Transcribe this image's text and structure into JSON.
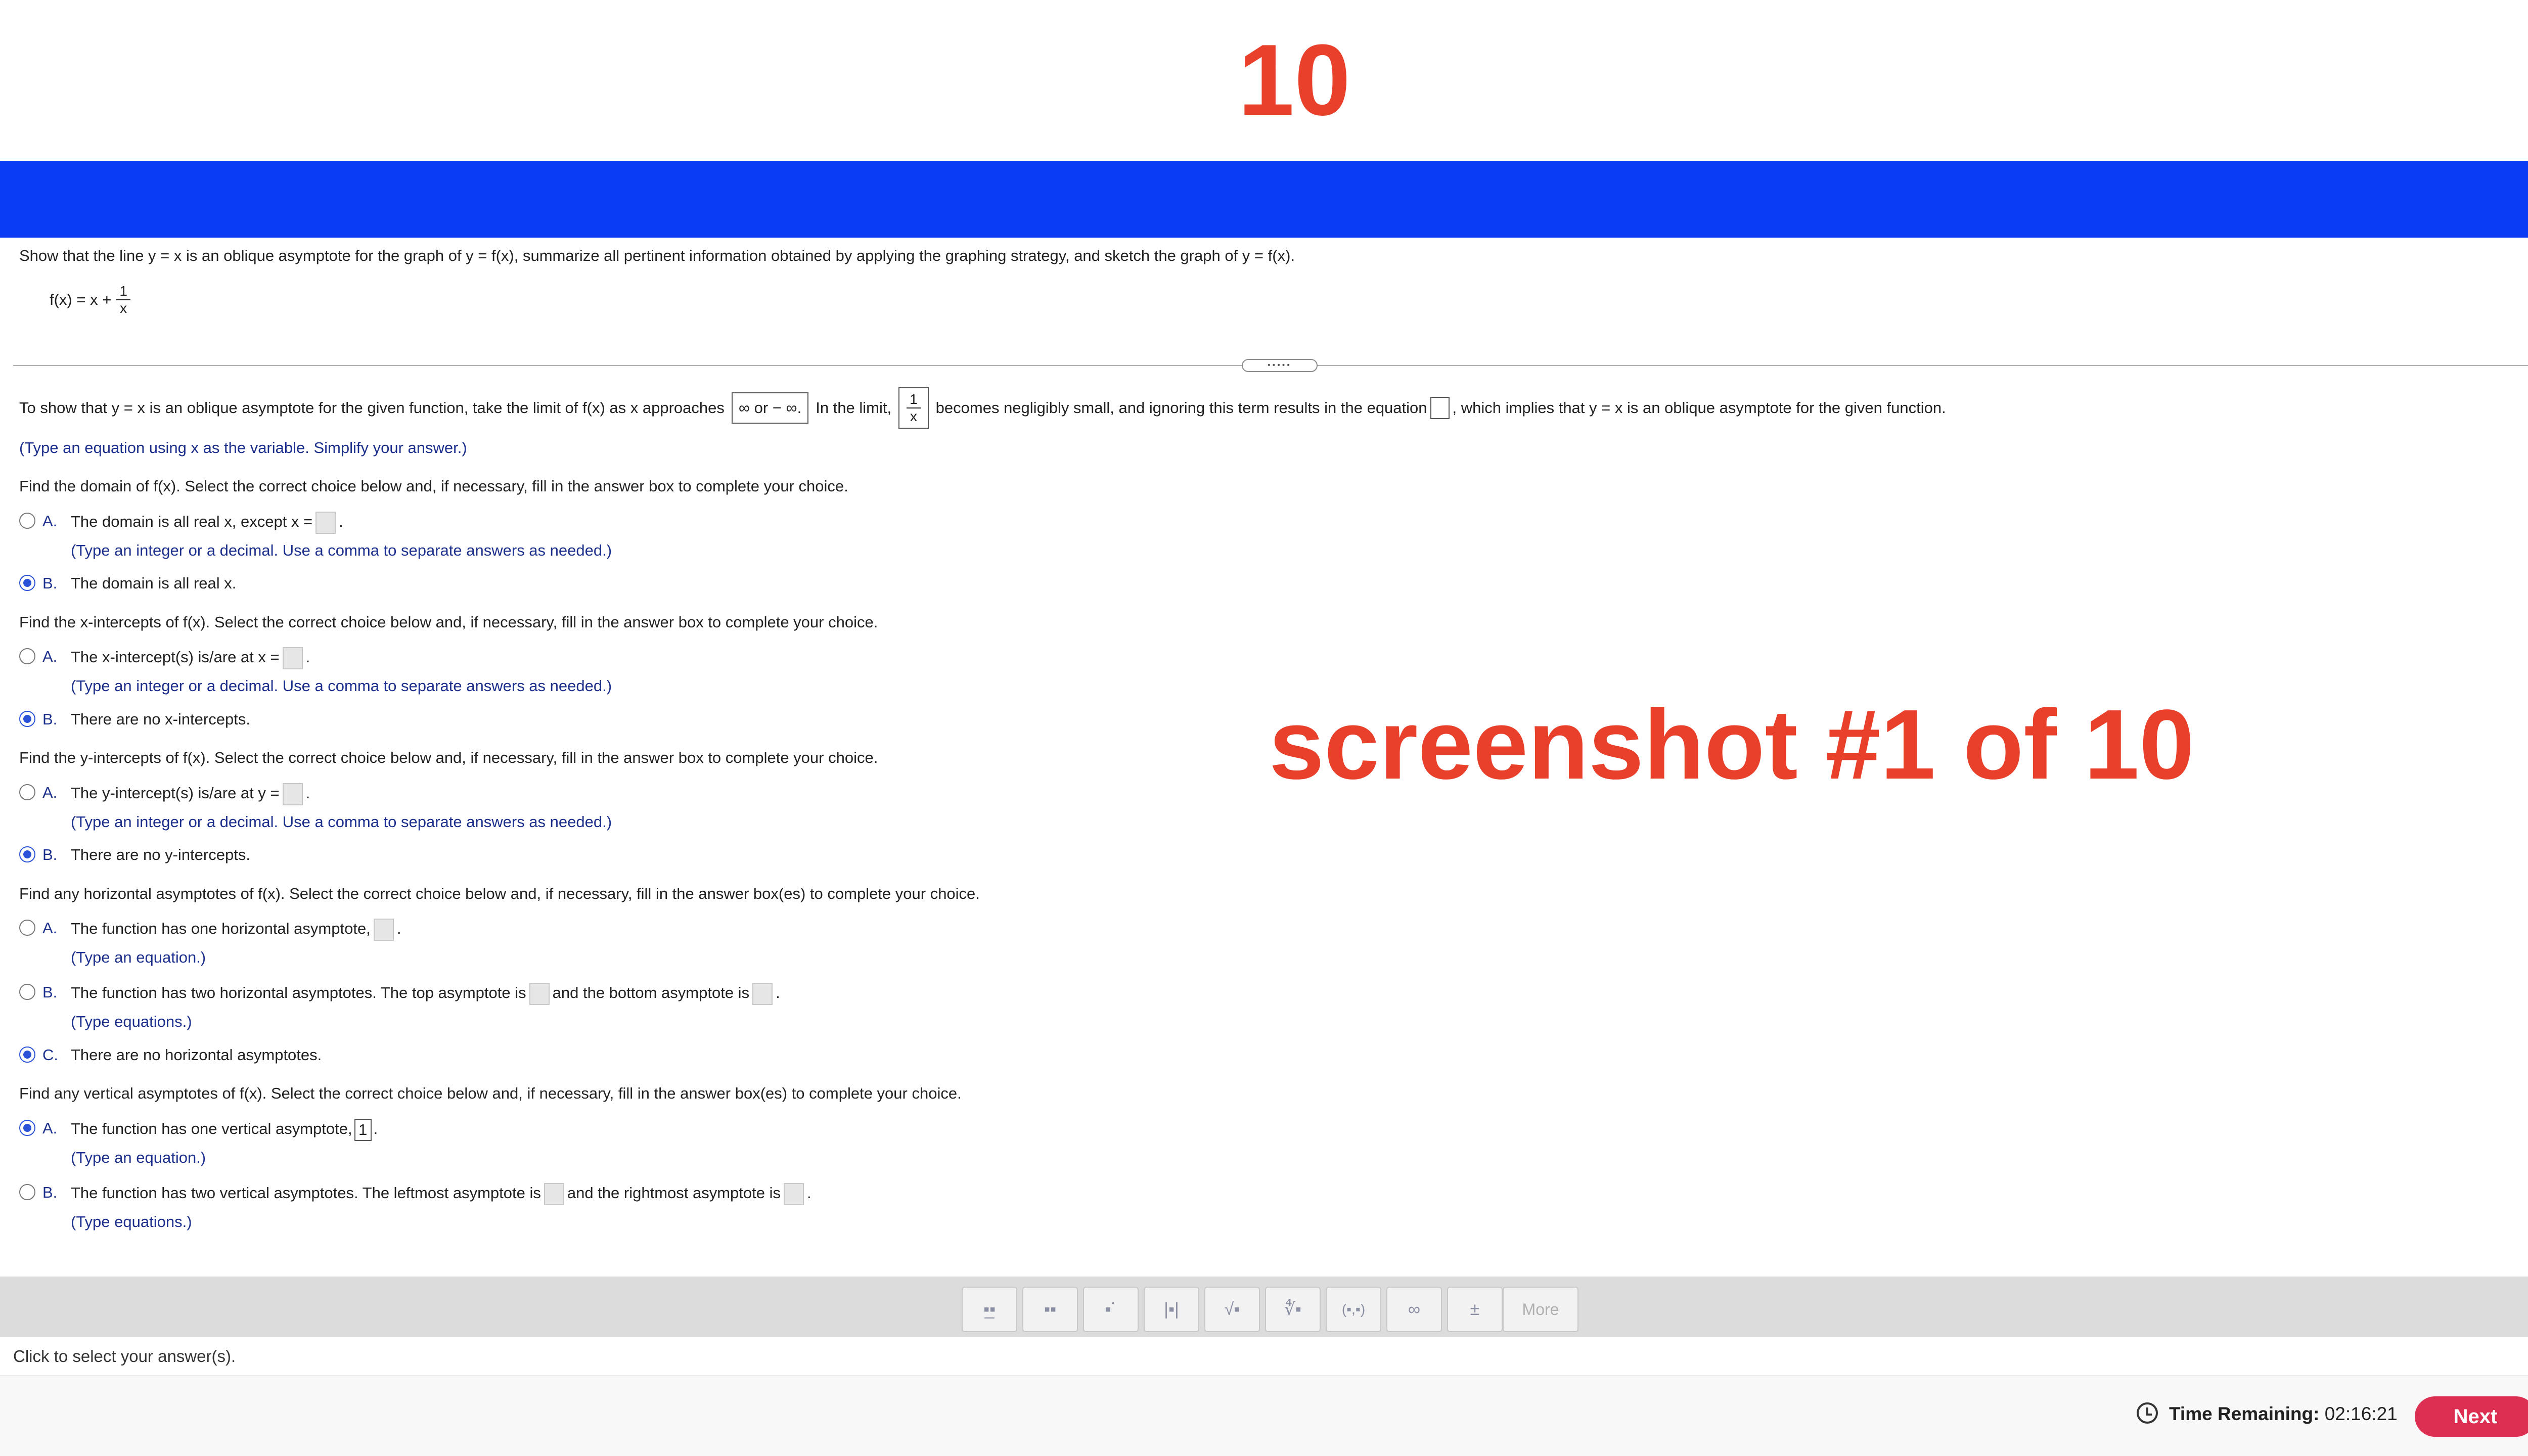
{
  "header": {
    "number": "10"
  },
  "watermark": "screenshot #1 of 10",
  "problem": {
    "statement": "Show that the line y = x is an oblique asymptote for the graph of y = f(x), summarize all pertinent information obtained by applying the graphing strategy, and sketch the graph of y = f(x).",
    "function_label": "f(x) = x +",
    "frac_num": "1",
    "frac_den": "x"
  },
  "limit_part": {
    "text1": "To show that y = x is an oblique asymptote for the given function, take the limit of f(x) as x approaches",
    "box_value": "∞ or − ∞.",
    "text2": "In the limit,",
    "frac_num": "1",
    "frac_den": "x",
    "text3": "becomes negligibly small, and ignoring this term results in the equation",
    "text4": ", which implies that y = x is an oblique asymptote for the given function.",
    "hint": "(Type an equation using x as the variable. Simplify your answer.)"
  },
  "domain": {
    "question": "Find the domain of f(x). Select the correct choice below and, if necessary, fill in the answer box to complete your choice.",
    "choices": [
      {
        "letter": "A.",
        "text": "The domain is all real x, except x =",
        "hint": "(Type an integer or a decimal. Use a comma to separate answers as needed.)"
      },
      {
        "letter": "B.",
        "text": "The domain is all real x."
      }
    ]
  },
  "x_intercepts": {
    "question": "Find the x-intercepts of f(x). Select the correct choice below and, if necessary, fill in the answer box to complete your choice.",
    "choices": [
      {
        "letter": "A.",
        "text": "The x-intercept(s) is/are at x =",
        "hint": "(Type an integer or a decimal. Use a comma to separate answers as needed.)"
      },
      {
        "letter": "B.",
        "text": "There are no x-intercepts."
      }
    ]
  },
  "y_intercepts": {
    "question": "Find the y-intercepts of f(x). Select the correct choice below and, if necessary, fill in the answer box to complete your choice.",
    "choices": [
      {
        "letter": "A.",
        "text": "The y-intercept(s) is/are at y =",
        "hint": "(Type an integer or a decimal. Use a comma to separate answers as needed.)"
      },
      {
        "letter": "B.",
        "text": "There are no y-intercepts."
      }
    ]
  },
  "horizontal": {
    "question": "Find any horizontal asymptotes of f(x). Select the correct choice below and, if necessary, fill in the answer box(es) to complete your choice.",
    "choices": [
      {
        "letter": "A.",
        "text": "The function has one horizontal asymptote,",
        "hint": "(Type an equation.)"
      },
      {
        "letter": "B.",
        "text": "The function has two horizontal asymptotes. The top asymptote is",
        "text_b": "and the bottom asymptote is",
        "hint": "(Type equations.)"
      },
      {
        "letter": "C.",
        "text": "There are no horizontal asymptotes."
      }
    ]
  },
  "vertical": {
    "question": "Find any vertical asymptotes of f(x). Select the correct choice below and, if necessary, fill in the answer box(es) to complete your choice.",
    "choices": [
      {
        "letter": "A.",
        "text": "The function has one vertical asymptote,",
        "value": "1",
        "hint": "(Type an equation.)"
      },
      {
        "letter": "B.",
        "text": "The function has two vertical asymptotes. The leftmost asymptote is",
        "text_b": "and the rightmost asymptote is",
        "hint": "(Type equations.)"
      }
    ]
  },
  "toolbar": {
    "buttons": [
      {
        "name": "fraction",
        "glyph": "▪̲▪"
      },
      {
        "name": "mixed-number",
        "glyph": "▪▪"
      },
      {
        "name": "exponent",
        "glyph": "▪˙"
      },
      {
        "name": "absolute-value",
        "glyph": "|▪|"
      },
      {
        "name": "square-root",
        "glyph": "√▪"
      },
      {
        "name": "nth-root",
        "glyph": "∜▪"
      },
      {
        "name": "ordered-pair",
        "glyph": "(▪,▪)"
      },
      {
        "name": "infinity",
        "glyph": "∞"
      },
      {
        "name": "plus-minus",
        "glyph": "±"
      }
    ],
    "more_label": "More"
  },
  "status": "Click to select your answer(s).",
  "footer": {
    "time_label": "Time Remaining:",
    "time_value": "02:16:21",
    "next_label": "Next"
  }
}
